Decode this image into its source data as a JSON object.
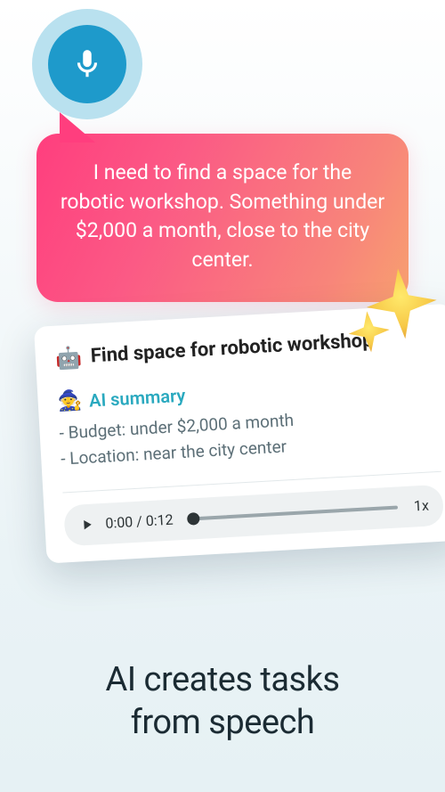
{
  "bubble": {
    "text": "I need to find a space for the robotic workshop. Something under $2,000 a month, close to the city center."
  },
  "card": {
    "emoji": "🤖",
    "title": "Find space for robotic workshop",
    "summary": {
      "icon": "🧙",
      "label": "AI summary",
      "lines": [
        "Budget: under $2,000 a month",
        "Location: near the city center"
      ]
    },
    "player": {
      "current": "0:00",
      "total": "0:12",
      "speed": "1x"
    }
  },
  "tagline": {
    "line1": "AI creates tasks",
    "line2": "from speech"
  }
}
